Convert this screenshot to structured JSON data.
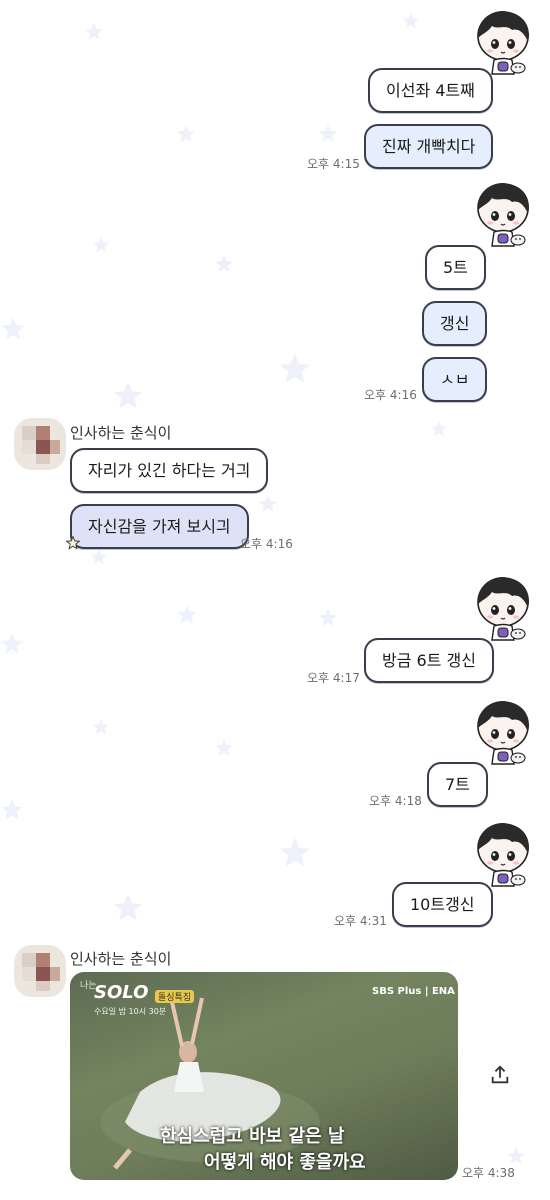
{
  "chat": {
    "other_name_1": "인사하는 춘식이",
    "other_name_2": "인사하는 춘식이",
    "messages": {
      "m1": "이선좌 4트째",
      "m2": "진짜 개빡치다",
      "t1": "오후 4:15",
      "m3": "5트",
      "m4": "갱신",
      "m5": "ㅅㅂ",
      "t2": "오후 4:16",
      "o1": "자리가 있긴 하다는 거긔",
      "o2": "자신감을 가져 보시긔",
      "t3": "오후 4:16",
      "m6": "방금 6트 갱신",
      "t4": "오후 4:17",
      "m7": "7트",
      "t5": "오후 4:18",
      "m8": "10트갱신",
      "t6": "오후 4:31",
      "t7": "오후 4:38"
    },
    "media": {
      "show_title": "SOLO",
      "show_prefix": "나는",
      "show_badge": "돌싱특집",
      "schedule": "수요일 밤 10시 30분",
      "network": "SBS Plus | ENA",
      "subtitle_1": "한심스럽고 바보 같은 날",
      "subtitle_2": "어떻게 해야 좋을까요"
    },
    "icons": {
      "share": "share-icon",
      "avatar_me": "chunsik-boy-avatar-icon",
      "avatar_other": "blurred-avatar"
    }
  }
}
